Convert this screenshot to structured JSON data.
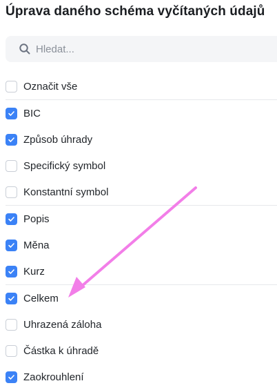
{
  "title": "Úprava daného schéma vyčítaných údajů",
  "search": {
    "placeholder": "Hledat...",
    "value": ""
  },
  "select_all": {
    "label": "Označit vše",
    "checked": false
  },
  "items": [
    {
      "label": "BIC",
      "checked": true
    },
    {
      "label": "Způsob úhrady",
      "checked": true
    },
    {
      "label": "Specifický symbol",
      "checked": false
    },
    {
      "label": "Konstantní symbol",
      "checked": false
    },
    {
      "label": "Popis",
      "checked": true
    },
    {
      "label": "Měna",
      "checked": true
    },
    {
      "label": "Kurz",
      "checked": true
    },
    {
      "label": "Celkem",
      "checked": true
    },
    {
      "label": "Uhrazená záloha",
      "checked": false
    },
    {
      "label": "Částka k úhradě",
      "checked": false
    },
    {
      "label": "Zaokrouhlení",
      "checked": true
    }
  ],
  "colors": {
    "checkbox_checked": "#3b82f6",
    "annotation_arrow": "#f27ee8"
  },
  "icons": {
    "search": "search-icon",
    "check": "check-icon",
    "annotation": "arrow-annotation"
  }
}
